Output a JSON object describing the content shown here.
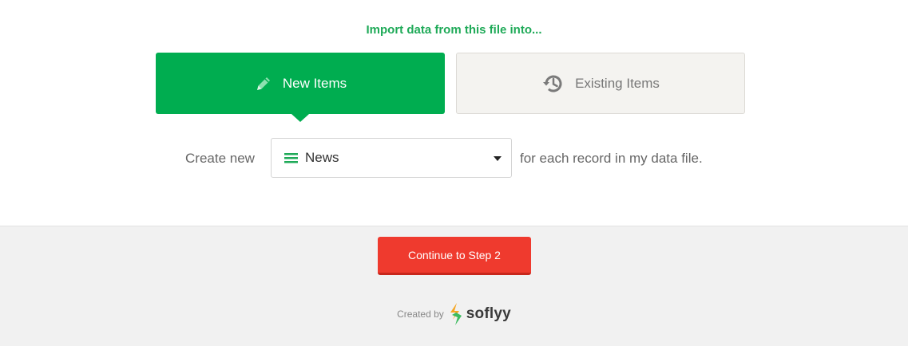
{
  "heading": "Import data from this file into...",
  "choices": {
    "new": {
      "label": "New Items",
      "icon": "pencil-icon",
      "selected": true
    },
    "existing": {
      "label": "Existing Items",
      "icon": "history-icon",
      "selected": false
    }
  },
  "create": {
    "prefix": "Create new",
    "select_value": "News",
    "select_icon": "list-icon",
    "suffix": "for each record in my data file."
  },
  "footer": {
    "continue_label": "Continue to Step 2",
    "created_by": "Created by",
    "brand": "soflyy"
  },
  "colors": {
    "accent_green": "#00ad50",
    "heading_green": "#1faa58",
    "button_red": "#ef3a2e"
  }
}
